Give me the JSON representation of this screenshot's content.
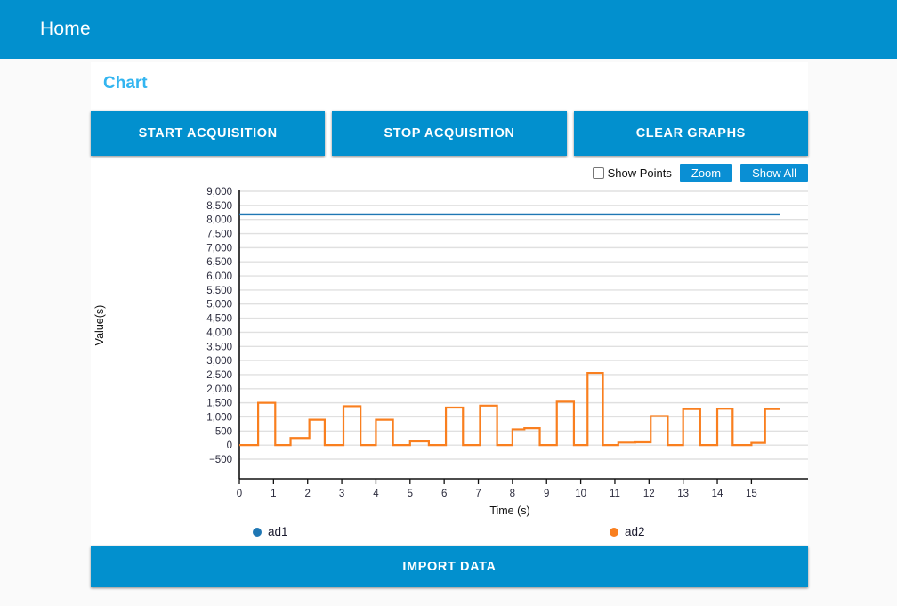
{
  "appbar": {
    "title": "Home"
  },
  "card": {
    "title": "Chart"
  },
  "actions": {
    "start_label": "START ACQUISITION",
    "stop_label": "STOP ACQUISITION",
    "clear_label": "CLEAR GRAPHS",
    "import_label": "IMPORT DATA"
  },
  "toolbar": {
    "show_points_label": "Show Points",
    "show_points_checked": false,
    "zoom_label": "Zoom",
    "show_all_label": "Show All"
  },
  "colors": {
    "primary": "#0290ce",
    "card_title": "#33b5f0",
    "series_ad1": "#1f77b4",
    "series_ad2": "#f97f1f",
    "grid": "#e0e0e0",
    "page_bg": "#fafafa"
  },
  "chart_data": {
    "type": "line",
    "title": "",
    "xlabel": "Time (s)",
    "ylabel": "Value(s)",
    "xlim": [
      0,
      15.85
    ],
    "ylim": [
      -500,
      9000
    ],
    "xticks": [
      0,
      1,
      2,
      3,
      4,
      5,
      6,
      7,
      8,
      9,
      10,
      11,
      12,
      13,
      14,
      15
    ],
    "xtick_labels": [
      "0",
      "1",
      "2",
      "3",
      "4",
      "5",
      "6",
      "7",
      "8",
      "9",
      "10",
      "11",
      "12",
      "13",
      "14",
      "15"
    ],
    "yticks": [
      -500,
      0,
      500,
      1000,
      1500,
      2000,
      2500,
      3000,
      3500,
      4000,
      4500,
      5000,
      5500,
      6000,
      6500,
      7000,
      7500,
      8000,
      8500,
      9000
    ],
    "ytick_labels": [
      "−500",
      "0",
      "500",
      "1,000",
      "1,500",
      "2,000",
      "2,500",
      "3,000",
      "3,500",
      "4,000",
      "4,500",
      "5,000",
      "5,500",
      "6,000",
      "6,500",
      "7,000",
      "7,500",
      "8,000",
      "8,500",
      "9,000"
    ],
    "grid": true,
    "legend_position": "bottom",
    "step": "post",
    "series": [
      {
        "name": "ad1",
        "color": "#1f77b4",
        "x": [
          0.0,
          15.85
        ],
        "values": [
          8180,
          8180
        ]
      },
      {
        "name": "ad2",
        "color": "#f97f1f",
        "x": [
          0.0,
          0.55,
          1.05,
          1.5,
          2.05,
          2.5,
          3.05,
          3.55,
          4.0,
          4.5,
          5.0,
          5.55,
          6.05,
          6.55,
          7.05,
          7.55,
          8.0,
          8.35,
          8.8,
          9.3,
          9.8,
          10.2,
          10.65,
          11.1,
          11.6,
          12.05,
          12.55,
          13.0,
          13.5,
          14.0,
          14.45,
          15.0,
          15.4,
          15.85
        ],
        "values": [
          0,
          1500,
          0,
          250,
          900,
          0,
          1380,
          0,
          900,
          0,
          130,
          0,
          1330,
          0,
          1400,
          0,
          560,
          600,
          0,
          1540,
          0,
          2560,
          0,
          90,
          100,
          1030,
          0,
          1280,
          0,
          1290,
          0,
          80,
          1280,
          1280
        ]
      }
    ]
  },
  "legend": [
    {
      "label": "ad1",
      "color": "#1f77b4"
    },
    {
      "label": "ad2",
      "color": "#f97f1f"
    }
  ]
}
